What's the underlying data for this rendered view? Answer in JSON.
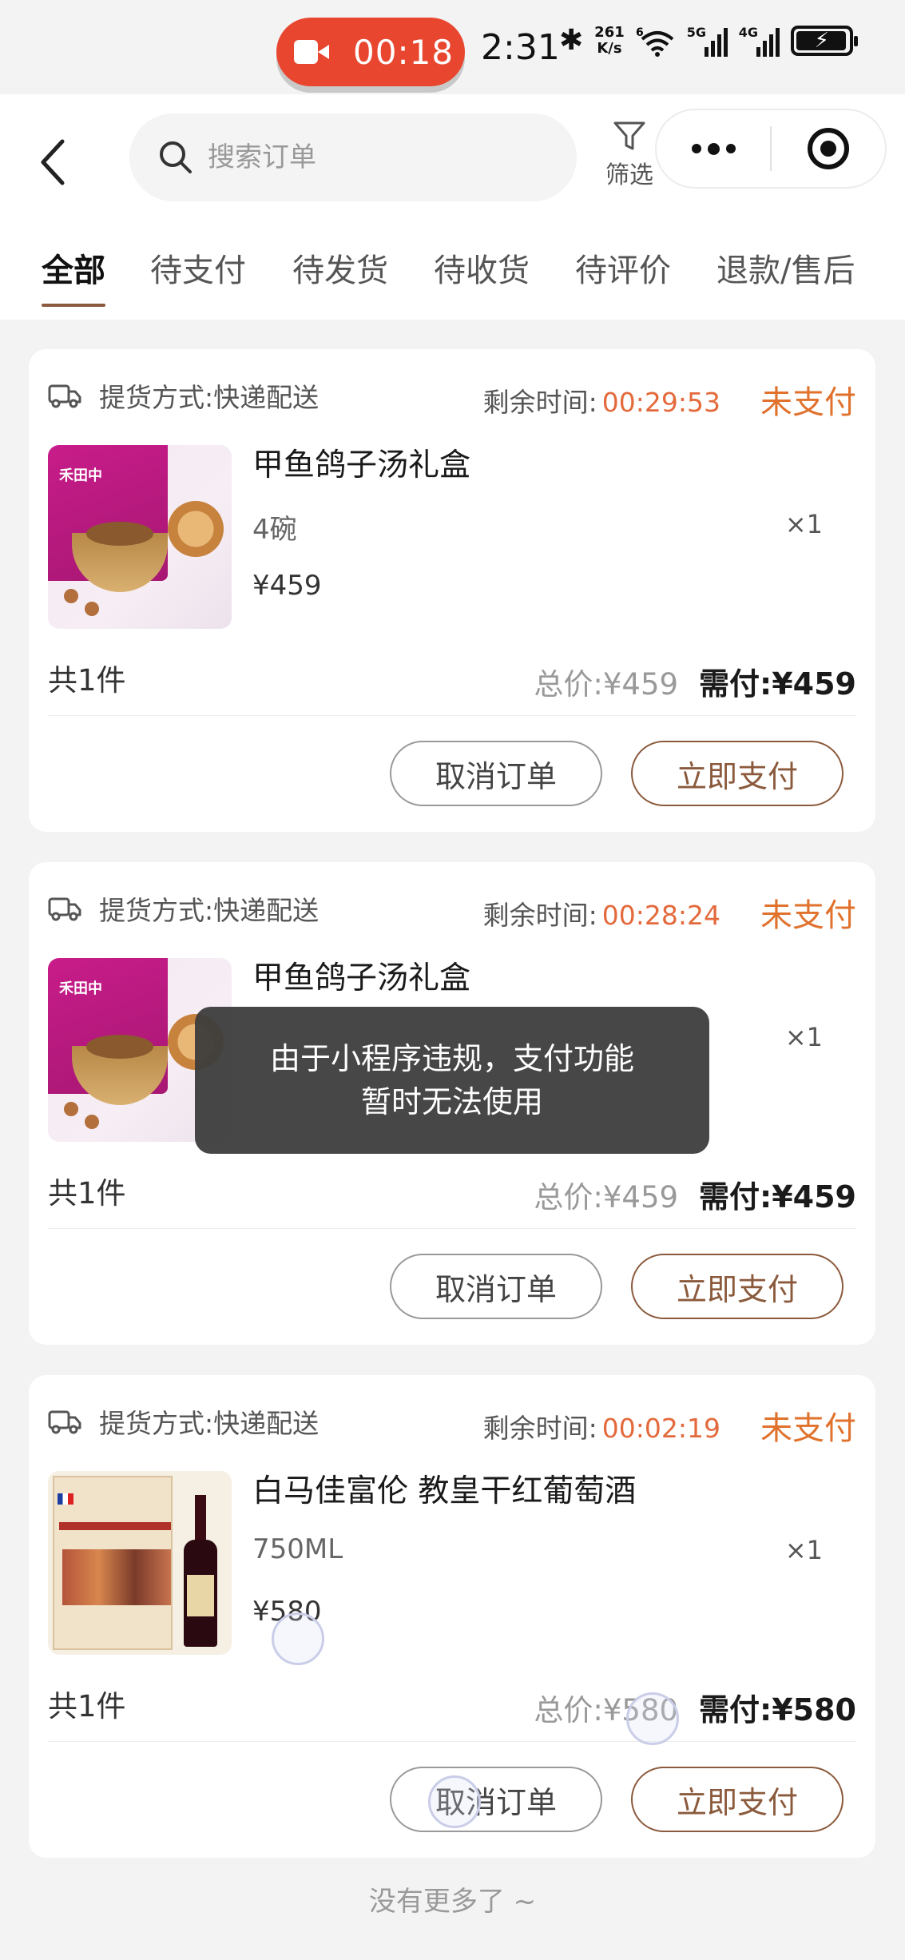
{
  "status_bar": {
    "recording_time": "00:18",
    "clock": "2:31",
    "speed_value": "261",
    "speed_unit": "K/s",
    "wifi_tag": "6",
    "net1": "5G",
    "net2": "4G"
  },
  "header": {
    "search_placeholder": "搜索订单",
    "filter_label": "筛选"
  },
  "tabs": [
    {
      "label": "全部",
      "active": true
    },
    {
      "label": "待支付"
    },
    {
      "label": "待发货"
    },
    {
      "label": "待收货"
    },
    {
      "label": "待评价"
    },
    {
      "label": "退款/售后"
    }
  ],
  "orders": [
    {
      "ship_label": "提货方式:",
      "ship_value": "快递配送",
      "remain_label": "剩余时间:",
      "remain_time": "00:29:53",
      "status": "未支付",
      "product_name": "甲鱼鸽子汤礼盒",
      "spec": "4碗",
      "price": "¥459",
      "qty": "×1",
      "count": "共1件",
      "total_label": "总价:",
      "total": "¥459",
      "need_label": "需付:",
      "need": "¥459",
      "cancel": "取消订单",
      "pay": "立即支付",
      "image": "soup-gift-box",
      "brand_text": "禾田中"
    },
    {
      "ship_label": "提货方式:",
      "ship_value": "快递配送",
      "remain_label": "剩余时间:",
      "remain_time": "00:28:24",
      "status": "未支付",
      "product_name": "甲鱼鸽子汤礼盒",
      "qty": "×1",
      "count": "共1件",
      "total_label": "总价:",
      "total": "¥459",
      "need_label": "需付:",
      "need": "¥459",
      "cancel": "取消订单",
      "pay": "立即支付",
      "image": "soup-gift-box",
      "brand_text": "禾田中"
    },
    {
      "ship_label": "提货方式:",
      "ship_value": "快递配送",
      "remain_label": "剩余时间:",
      "remain_time": "00:02:19",
      "status": "未支付",
      "product_name": "白马佳富伦 教皇干红葡萄酒",
      "spec": "750ML",
      "price": "¥580",
      "qty": "×1",
      "count": "共1件",
      "total_label": "总价:",
      "total": "¥580",
      "need_label": "需付:",
      "need": "¥580",
      "cancel": "取消订单",
      "pay": "立即支付",
      "image": "red-wine"
    }
  ],
  "toast": {
    "line1": "由于小程序违规，支付功能",
    "line2": "暂时无法使用"
  },
  "footer": {
    "no_more": "没有更多了 ~"
  },
  "colors": {
    "accent": "#8b5a3c",
    "unpaid": "#e0722e",
    "timer": "#e36a3c",
    "recording": "#e8462f"
  }
}
